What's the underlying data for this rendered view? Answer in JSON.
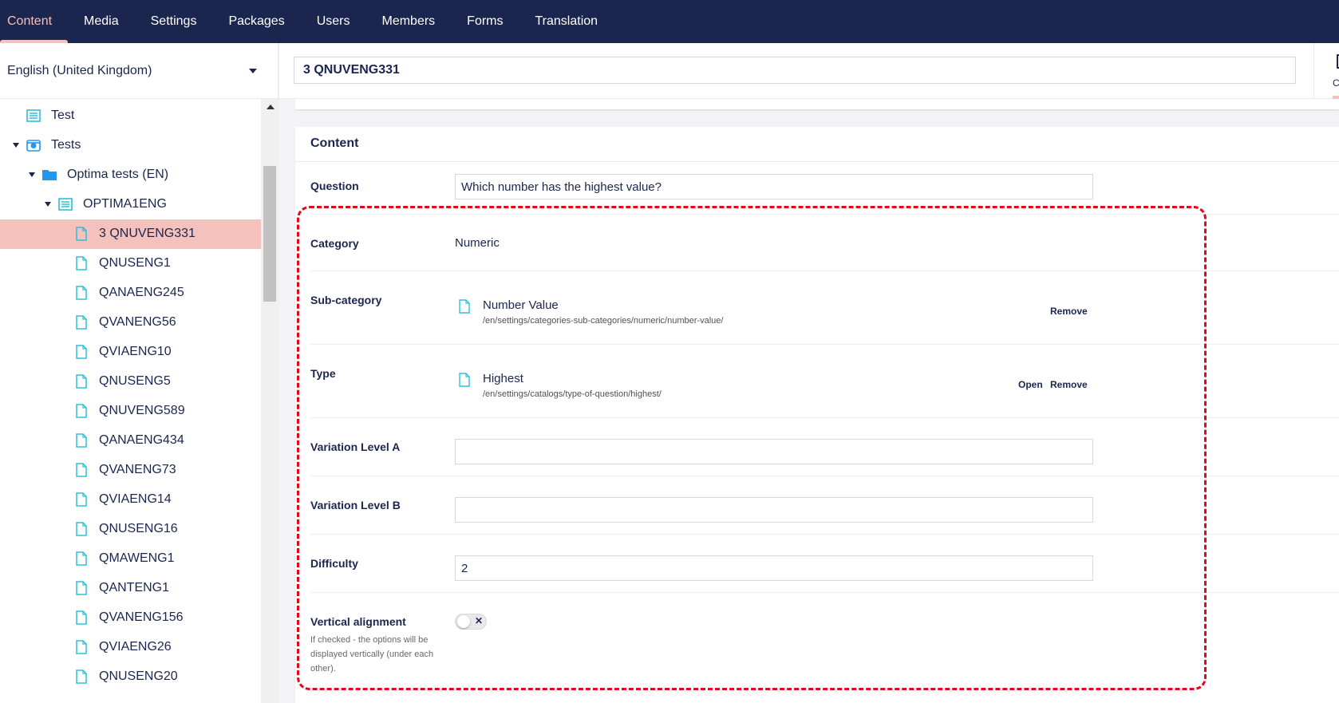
{
  "nav": {
    "items": [
      "Content",
      "Media",
      "Settings",
      "Packages",
      "Users",
      "Members",
      "Forms",
      "Translation"
    ],
    "active_index": 0
  },
  "sidebar": {
    "language": "English (United Kingdom)",
    "tree": [
      {
        "label": "Test",
        "icon": "list-icon",
        "level": 1,
        "expanded": null
      },
      {
        "label": "Tests",
        "icon": "globe-icon",
        "level": 1,
        "expanded": true
      },
      {
        "label": "Optima tests (EN)",
        "icon": "folder-icon",
        "level": 2,
        "expanded": true
      },
      {
        "label": "OPTIMA1ENG",
        "icon": "list-icon",
        "level": 3,
        "expanded": true
      },
      {
        "label": "3 QNUVENG331",
        "icon": "document-icon",
        "level": 4,
        "selected": true
      },
      {
        "label": "QNUSENG1",
        "icon": "document-icon",
        "level": 4
      },
      {
        "label": "QANAENG245",
        "icon": "document-icon",
        "level": 4
      },
      {
        "label": "QVANENG56",
        "icon": "document-icon",
        "level": 4
      },
      {
        "label": "QVIAENG10",
        "icon": "document-icon",
        "level": 4
      },
      {
        "label": "QNUSENG5",
        "icon": "document-icon",
        "level": 4
      },
      {
        "label": "QNUVENG589",
        "icon": "document-icon",
        "level": 4
      },
      {
        "label": "QANAENG434",
        "icon": "document-icon",
        "level": 4
      },
      {
        "label": "QVANENG73",
        "icon": "document-icon",
        "level": 4
      },
      {
        "label": "QVIAENG14",
        "icon": "document-icon",
        "level": 4
      },
      {
        "label": "QNUSENG16",
        "icon": "document-icon",
        "level": 4
      },
      {
        "label": "QMAWENG1",
        "icon": "document-icon",
        "level": 4
      },
      {
        "label": "QANTENG1",
        "icon": "document-icon",
        "level": 4
      },
      {
        "label": "QVANENG156",
        "icon": "document-icon",
        "level": 4
      },
      {
        "label": "QVIAENG26",
        "icon": "document-icon",
        "level": 4
      },
      {
        "label": "QNUSENG20",
        "icon": "document-icon",
        "level": 4
      }
    ]
  },
  "header": {
    "node_name": "3 QNUVENG331",
    "app_tab_label": "Cor"
  },
  "content": {
    "group_title": "Content",
    "question": {
      "label": "Question",
      "value": "Which number has the highest value?"
    },
    "category": {
      "label": "Category",
      "value": "Numeric"
    },
    "subcategory": {
      "label": "Sub-category",
      "name": "Number Value",
      "path": "/en/settings/categories-sub-categories/numeric/number-value/",
      "remove_label": "Remove"
    },
    "type": {
      "label": "Type",
      "name": "Highest",
      "path": "/en/settings/catalogs/type-of-question/highest/",
      "open_label": "Open",
      "remove_label": "Remove"
    },
    "variation_a": {
      "label": "Variation Level A",
      "value": ""
    },
    "variation_b": {
      "label": "Variation Level B",
      "value": ""
    },
    "difficulty": {
      "label": "Difficulty",
      "value": "2"
    },
    "vertical_alignment": {
      "label": "Vertical alignment",
      "description": "If checked - the options will be displayed vertically (under each other).",
      "checked": false,
      "toggle_symbol": "✕"
    }
  },
  "colors": {
    "nav_bg": "#1b264f",
    "accent": "#f5c1bc",
    "highlight": "#e3061b",
    "icon_teal": "#2bc0d8",
    "folder_blue": "#2196f3"
  }
}
